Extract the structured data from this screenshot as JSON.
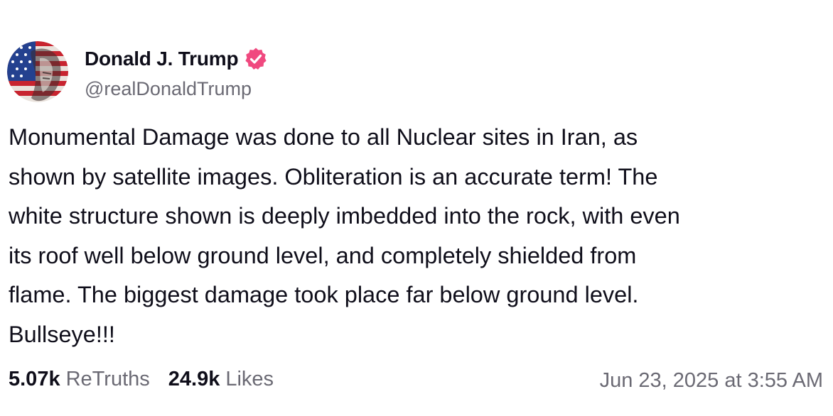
{
  "author": {
    "display_name": "Donald J. Trump",
    "handle": "@realDonaldTrump",
    "verified": true,
    "verified_badge_color": "#f0497f",
    "avatar_icon": "flag-painted-portrait-avatar"
  },
  "post": {
    "text": "Monumental Damage was done to all Nuclear sites in Iran, as\nshown by satellite images. Obliteration is an accurate term! The\nwhite structure shown is deeply imbedded into the rock, with even\nits roof well below ground level, and completely shielded from\nflame. The biggest damage took place far below ground level.\nBullseye!!!"
  },
  "stats": {
    "retruths_count": "5.07k",
    "retruths_label": "ReTruths",
    "likes_count": "24.9k",
    "likes_label": "Likes"
  },
  "timestamp": "Jun 23, 2025 at 3:55 AM",
  "colors": {
    "text_primary": "#0f0e1a",
    "text_secondary": "#6b6a74",
    "background": "#ffffff"
  }
}
